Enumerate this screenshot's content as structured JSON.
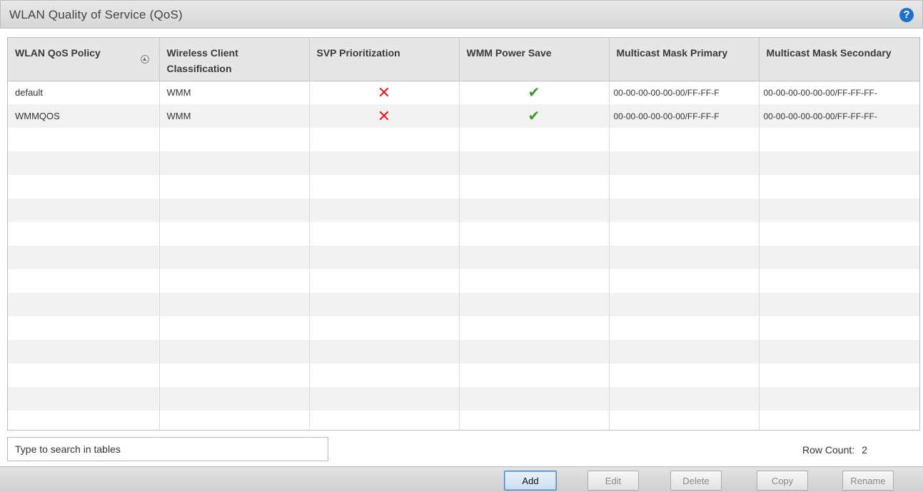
{
  "header": {
    "title": "WLAN Quality of Service (QoS)",
    "help_icon": "help-icon"
  },
  "table": {
    "columns": [
      "WLAN QoS Policy",
      "Wireless Client Classification",
      "SVP Prioritization",
      "WMM Power Save",
      "Multicast Mask Primary",
      "Multicast Mask Secondary"
    ],
    "rows": [
      {
        "policy": "default",
        "classification": "WMM",
        "svp": "✕",
        "wmm_power_save": "✔",
        "mask_primary": "00-00-00-00-00-00/FF-FF-F",
        "mask_secondary": "00-00-00-00-00-00/FF-FF-FF-"
      },
      {
        "policy": "WMMQOS",
        "classification": "WMM",
        "svp": "✕",
        "wmm_power_save": "✔",
        "mask_primary": "00-00-00-00-00-00/FF-FF-F",
        "mask_secondary": "00-00-00-00-00-00/FF-FF-FF-"
      }
    ]
  },
  "search": {
    "placeholder": "Type to search in tables"
  },
  "row_count": {
    "label": "Row Count:",
    "value": "2"
  },
  "buttons": {
    "add": "Add",
    "edit": "Edit",
    "delete": "Delete",
    "copy": "Copy",
    "rename": "Rename"
  },
  "colors": {
    "accent": "#1e73c9",
    "error": "#e02020",
    "success": "#3a9b2a"
  }
}
